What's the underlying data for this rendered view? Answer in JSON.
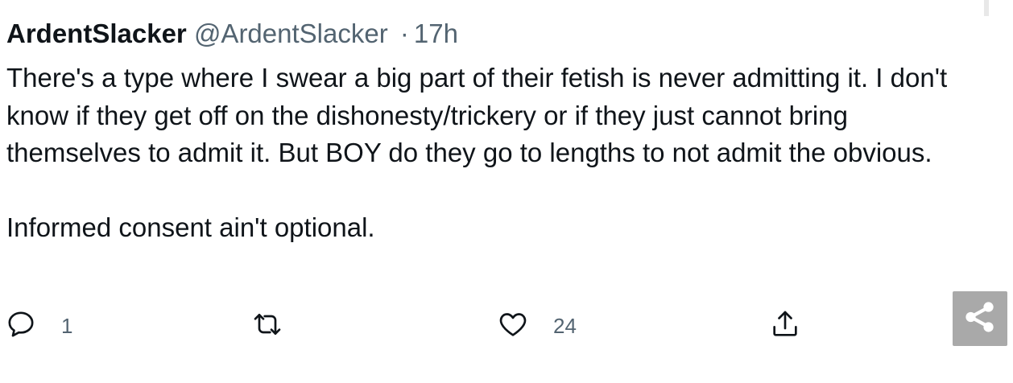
{
  "tweet": {
    "display_name": "ArdentSlacker",
    "handle": "@ArdentSlacker",
    "separator": "·",
    "time": "17h",
    "paragraph_1": "There's a type where I swear a big part of their fetish is never admitting it. I don't know if they get off on the dishonesty/trickery or if they just cannot bring themselves to admit it. But BOY do they go to lengths to not admit the obvious.",
    "paragraph_2": "Informed consent ain't optional."
  },
  "actions": {
    "reply": {
      "icon": "reply-icon",
      "count": "1"
    },
    "retweet": {
      "icon": "retweet-icon",
      "count": ""
    },
    "like": {
      "icon": "heart-icon",
      "count": "24"
    },
    "share": {
      "icon": "share-upload-icon"
    }
  },
  "overlay": {
    "share_badge_icon": "share-nodes-icon"
  },
  "colors": {
    "text_primary": "#0f1419",
    "text_secondary": "#536471",
    "badge_background": "#a9a9a9"
  }
}
